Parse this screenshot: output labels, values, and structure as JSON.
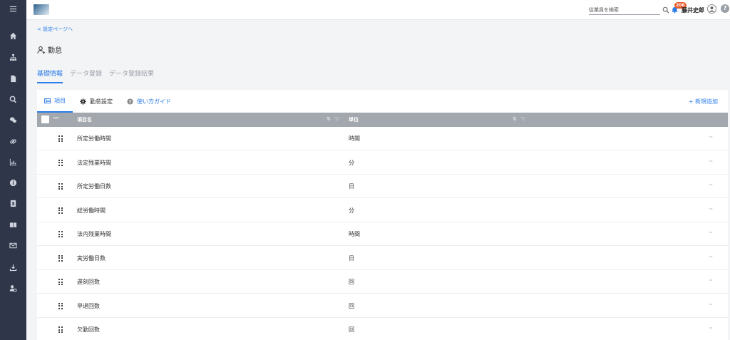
{
  "sidebar": {
    "items": [
      {
        "icon": "menu-icon"
      },
      {
        "icon": "home-icon"
      },
      {
        "icon": "org-chart-icon"
      },
      {
        "icon": "document-icon"
      },
      {
        "icon": "search-icon"
      },
      {
        "icon": "chat-icon"
      },
      {
        "icon": "link-icon"
      },
      {
        "icon": "bar-chart-icon"
      },
      {
        "icon": "info-icon"
      },
      {
        "icon": "contact-book-icon"
      },
      {
        "icon": "open-book-icon"
      },
      {
        "icon": "mail-icon"
      },
      {
        "icon": "download-icon"
      },
      {
        "icon": "user-settings-icon"
      }
    ]
  },
  "header": {
    "search_placeholder": "従業員を検索",
    "notification_count": "206",
    "user_name": "藤井史郎",
    "help": "?"
  },
  "breadcrumb": {
    "back_label": "設定ページへ",
    "back_arrow": "<"
  },
  "page": {
    "title": "勤怠"
  },
  "tabs": [
    {
      "label": "基礎情報"
    },
    {
      "label": "データ登録"
    },
    {
      "label": "データ登録結果"
    }
  ],
  "subtabs": [
    {
      "label": "項目"
    },
    {
      "label": "勤怠設定"
    },
    {
      "label": "使い方ガイド"
    }
  ],
  "add_new_label": "+ 新規追加",
  "table": {
    "select_all_dash": "—",
    "columns": {
      "name": "項目名",
      "unit": "単位"
    },
    "rows": [
      {
        "name": "所定労働時間",
        "unit": "時間"
      },
      {
        "name": "法定残業時間",
        "unit": "分"
      },
      {
        "name": "所定労働日数",
        "unit": "日"
      },
      {
        "name": "総労働時間",
        "unit": "分"
      },
      {
        "name": "法内残業時間",
        "unit": "時間"
      },
      {
        "name": "実労働日数",
        "unit": "日"
      },
      {
        "name": "遅刻回数",
        "unit": "回"
      },
      {
        "name": "早退回数",
        "unit": "回"
      },
      {
        "name": "欠勤回数",
        "unit": "回"
      }
    ],
    "more_label": "···"
  },
  "colors": {
    "sidebar_bg": "#2f3649",
    "accent": "#2b7de9",
    "table_header_bg": "#a3a7ae",
    "badge": "#e95b2b"
  }
}
